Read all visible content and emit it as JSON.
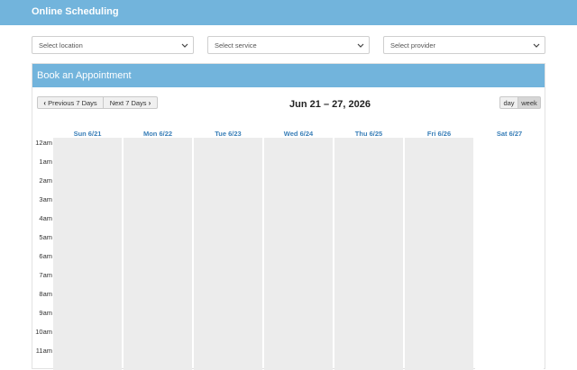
{
  "app": {
    "title": "Online Scheduling"
  },
  "filters": {
    "location_placeholder": "Select location",
    "service_placeholder": "Select service",
    "provider_placeholder": "Select provider"
  },
  "panel": {
    "title": "Book an Appointment"
  },
  "toolbar": {
    "prev_label": "Previous 7 Days",
    "next_label": "Next 7 Days",
    "range_label": "Jun 21 – 27, 2026",
    "day_label": "day",
    "week_label": "week",
    "active_view": "week"
  },
  "days": [
    "Sun 6/21",
    "Mon 6/22",
    "Tue 6/23",
    "Wed 6/24",
    "Thu 6/25",
    "Fri 6/26",
    "Sat 6/27"
  ],
  "hours": [
    "12am",
    "1am",
    "2am",
    "3am",
    "4am",
    "5am",
    "6am",
    "7am",
    "8am",
    "9am",
    "10am",
    "11am"
  ],
  "colors": {
    "accent": "#72b4dc",
    "day_header": "#3a7fb8",
    "unavailable": "#ececec"
  }
}
